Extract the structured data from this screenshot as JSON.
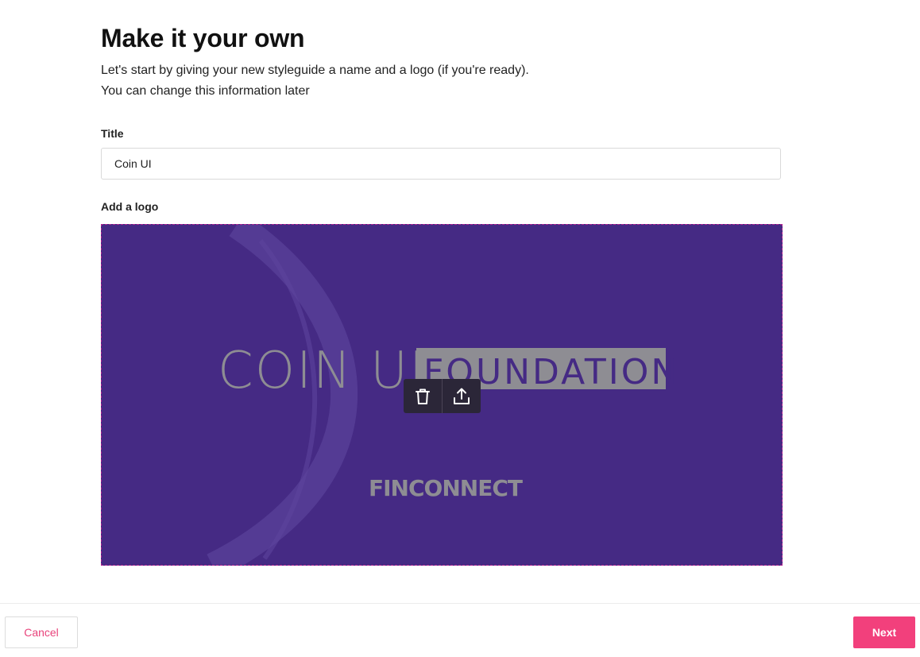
{
  "header": {
    "title": "Make it your own",
    "subtitle_line1": "Let's start by giving your new styleguide a name and a logo (if you're ready).",
    "subtitle_line2": "You can change this information later"
  },
  "form": {
    "title_label": "Title",
    "title_value": "Coin UI",
    "logo_label": "Add a logo"
  },
  "logo_image": {
    "brand_left": "COIN UI",
    "brand_right": "FOUNDATION",
    "sub_brand": "FINCONNECT",
    "background_color": "#452a84"
  },
  "logo_toolbar": {
    "delete_icon": "trash-icon",
    "upload_icon": "upload-icon"
  },
  "footer": {
    "cancel_label": "Cancel",
    "next_label": "Next",
    "accent_color": "#f2407c"
  }
}
